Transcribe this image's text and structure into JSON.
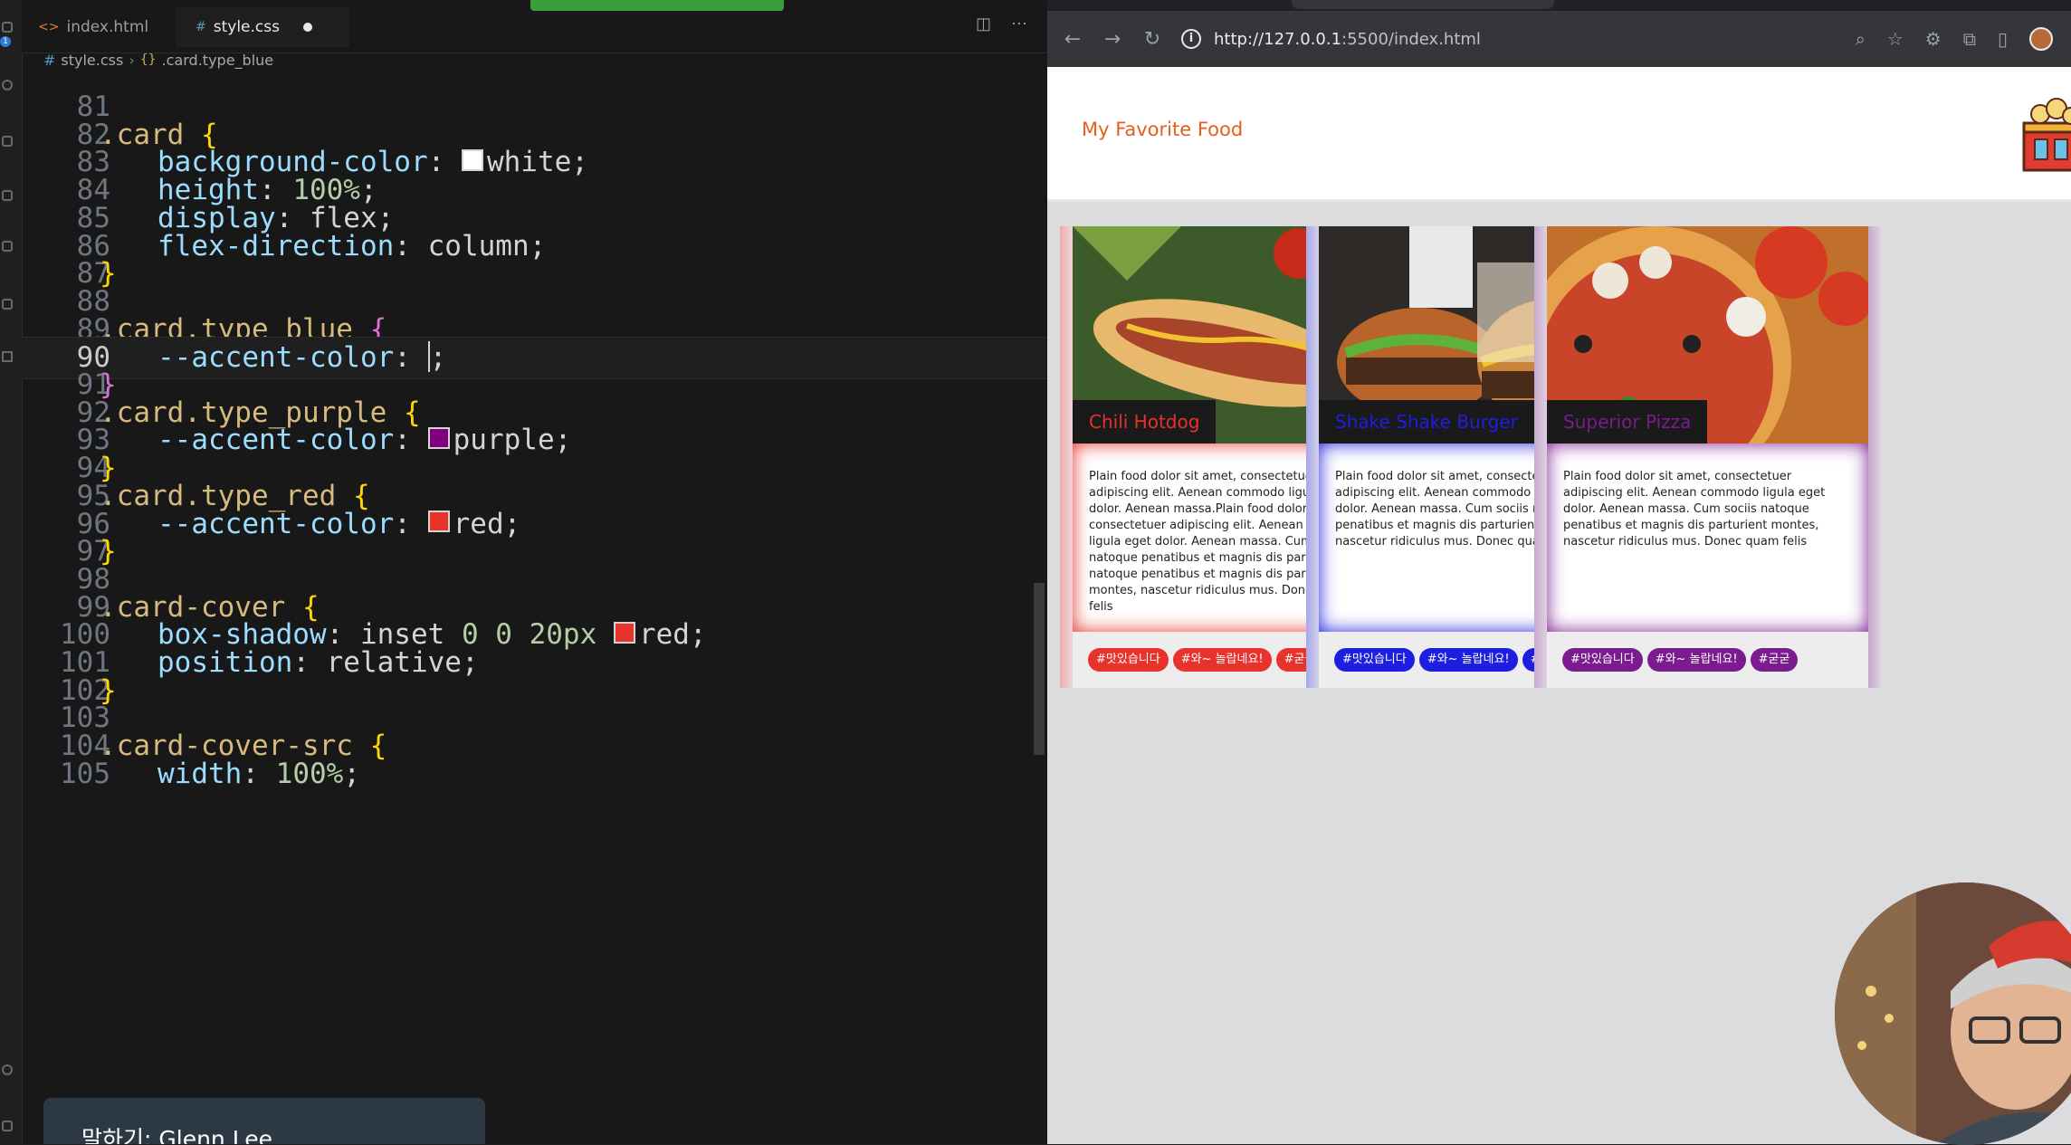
{
  "editor": {
    "tabs": [
      {
        "label": "index.html",
        "icon": "html-file-icon"
      },
      {
        "label": "style.css",
        "icon": "css-file-icon",
        "modified": true
      }
    ],
    "breadcrumb": {
      "file": "style.css",
      "symbol": ".card.type_blue"
    },
    "lines": [
      {
        "n": "81"
      },
      {
        "n": "82",
        "sel": ".card",
        "open": "{"
      },
      {
        "n": "83",
        "prop": "background-color",
        "swatch": "#ffffff",
        "val": "white;"
      },
      {
        "n": "84",
        "prop": "height",
        "num": "100%",
        "val": ";"
      },
      {
        "n": "85",
        "prop": "display",
        "val": "flex;"
      },
      {
        "n": "86",
        "prop": "flex-direction",
        "val": "column;"
      },
      {
        "n": "87",
        "close": "}"
      },
      {
        "n": "88"
      },
      {
        "n": "89",
        "sel": ".card.type_blue",
        "open": "{"
      },
      {
        "n": "90",
        "var": "--accent-color",
        "val": ";"
      },
      {
        "n": "91",
        "close": "}"
      },
      {
        "n": "92",
        "sel": ".card.type_purple",
        "open": "{"
      },
      {
        "n": "93",
        "var": "--accent-color",
        "swatch": "#800080",
        "val": "purple;"
      },
      {
        "n": "94",
        "close": "}"
      },
      {
        "n": "95",
        "sel": ".card.type_red",
        "open": "{"
      },
      {
        "n": "96",
        "var": "--accent-color",
        "swatch": "#e8322c",
        "val": "red;"
      },
      {
        "n": "97",
        "close": "}"
      },
      {
        "n": "98"
      },
      {
        "n": "99",
        "sel": ".card-cover",
        "open": "{"
      },
      {
        "n": "100",
        "prop": "box-shadow",
        "val1": "inset ",
        "num": "0 0 20px",
        "swatch": "#e8322c",
        "val": "red;"
      },
      {
        "n": "101",
        "prop": "position",
        "val": "relative;"
      },
      {
        "n": "102",
        "close": "}"
      },
      {
        "n": "103"
      },
      {
        "n": "104",
        "sel": ".card-cover-src",
        "open": "{"
      },
      {
        "n": "105",
        "prop": "width",
        "num": "100%",
        "val": ";"
      }
    ],
    "toast": "말하기: Glenn Lee"
  },
  "browser": {
    "url_host": "http://127.0.0.1",
    "url_rest": ":5500/index.html",
    "brand": "My Favorite Food",
    "cards": [
      {
        "title": "Chili Hotdog",
        "accent": "#e8322c",
        "image": "hotdog-image",
        "text": "Plain food dolor sit amet, consectetuer adipiscing elit. Aenean commodo ligula eget dolor. Aenean massa.Plain food dolor sit amet, consectetuer adipiscing elit. Aenean commodo ligula eget dolor. Aenean massa. Cum sociis natoque penatibus et magnis dis par Cum sociis natoque penatibus et magnis dis parturient montes, nascetur ridiculus mus. Donec quam felis",
        "tags": [
          "#맛있습니다",
          "#와~ 놀랍네요!",
          "#굳굳"
        ]
      },
      {
        "title": "Shake Shake Burger",
        "accent": "#1e1ee0",
        "image": "burger-image",
        "text": "Plain food dolor sit amet, consectetuer adipiscing elit. Aenean commodo ligula eget dolor. Aenean massa. Cum sociis natoque penatibus et magnis dis parturient montes, nascetur ridiculus mus. Donec quam felis",
        "tags": [
          "#맛있습니다",
          "#와~ 놀랍네요!",
          "#굳굳"
        ]
      },
      {
        "title": "Superior Pizza",
        "accent": "#7b1c8e",
        "image": "pizza-image",
        "text": "Plain food dolor sit amet, consectetuer adipiscing elit. Aenean commodo ligula eget dolor. Aenean massa. Cum sociis natoque penatibus et magnis dis parturient montes, nascetur ridiculus mus. Donec quam felis",
        "tags": [
          "#맛있습니다",
          "#와~ 놀랍네요!",
          "#굳굳"
        ]
      }
    ]
  }
}
